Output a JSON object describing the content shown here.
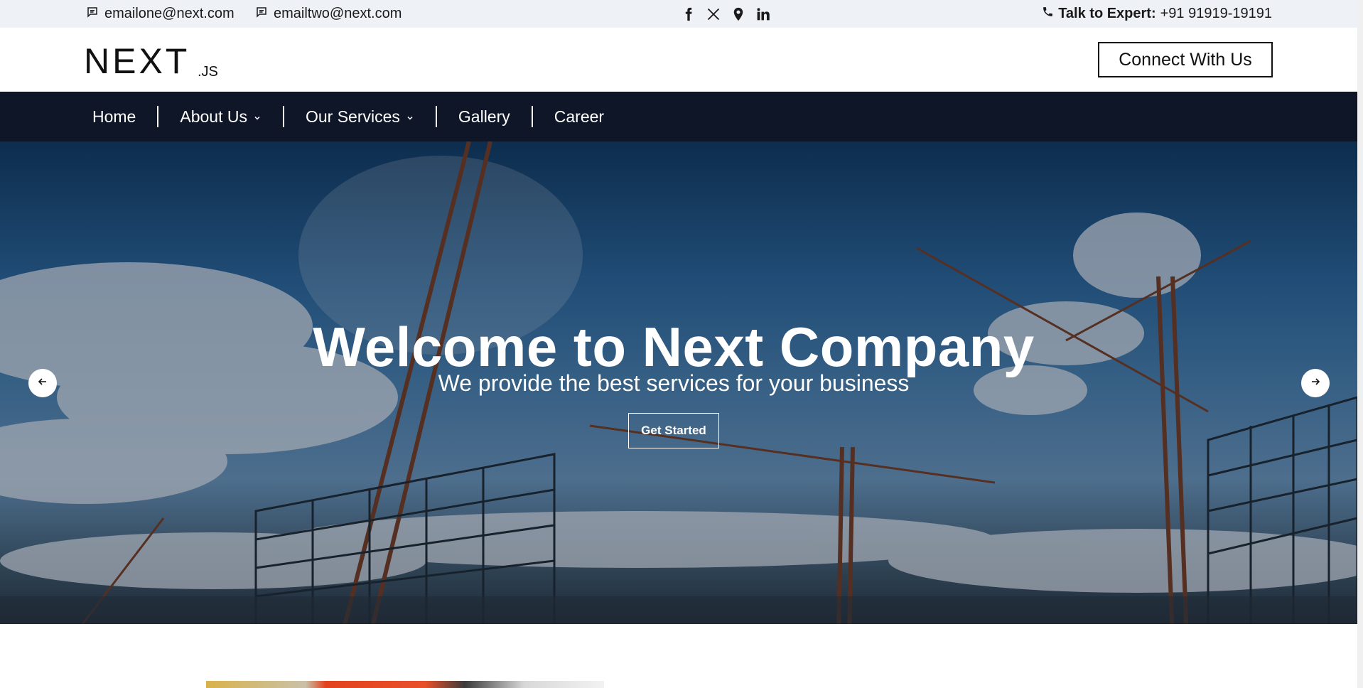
{
  "topbar": {
    "email_one": "emailone@next.com",
    "email_two": "emailtwo@next.com",
    "socials": [
      "facebook-icon",
      "x-icon",
      "map-pin-icon",
      "linkedin-icon"
    ],
    "expert_label": "Talk to Expert:",
    "expert_phone": "+91 91919-19191"
  },
  "header": {
    "logo_text": "NEXT",
    "logo_suffix": ".JS",
    "connect_label": "Connect With Us"
  },
  "nav": {
    "home": "Home",
    "about": "About Us",
    "services": "Our Services",
    "gallery": "Gallery",
    "career": "Career"
  },
  "hero": {
    "title": "Welcome to Next Company",
    "subtitle": "We provide the best services for your business",
    "cta_label": "Get Started"
  },
  "colors": {
    "topbar_bg": "#eef2f7",
    "nav_bg": "#0e1628",
    "text": "#111111",
    "white": "#ffffff"
  }
}
